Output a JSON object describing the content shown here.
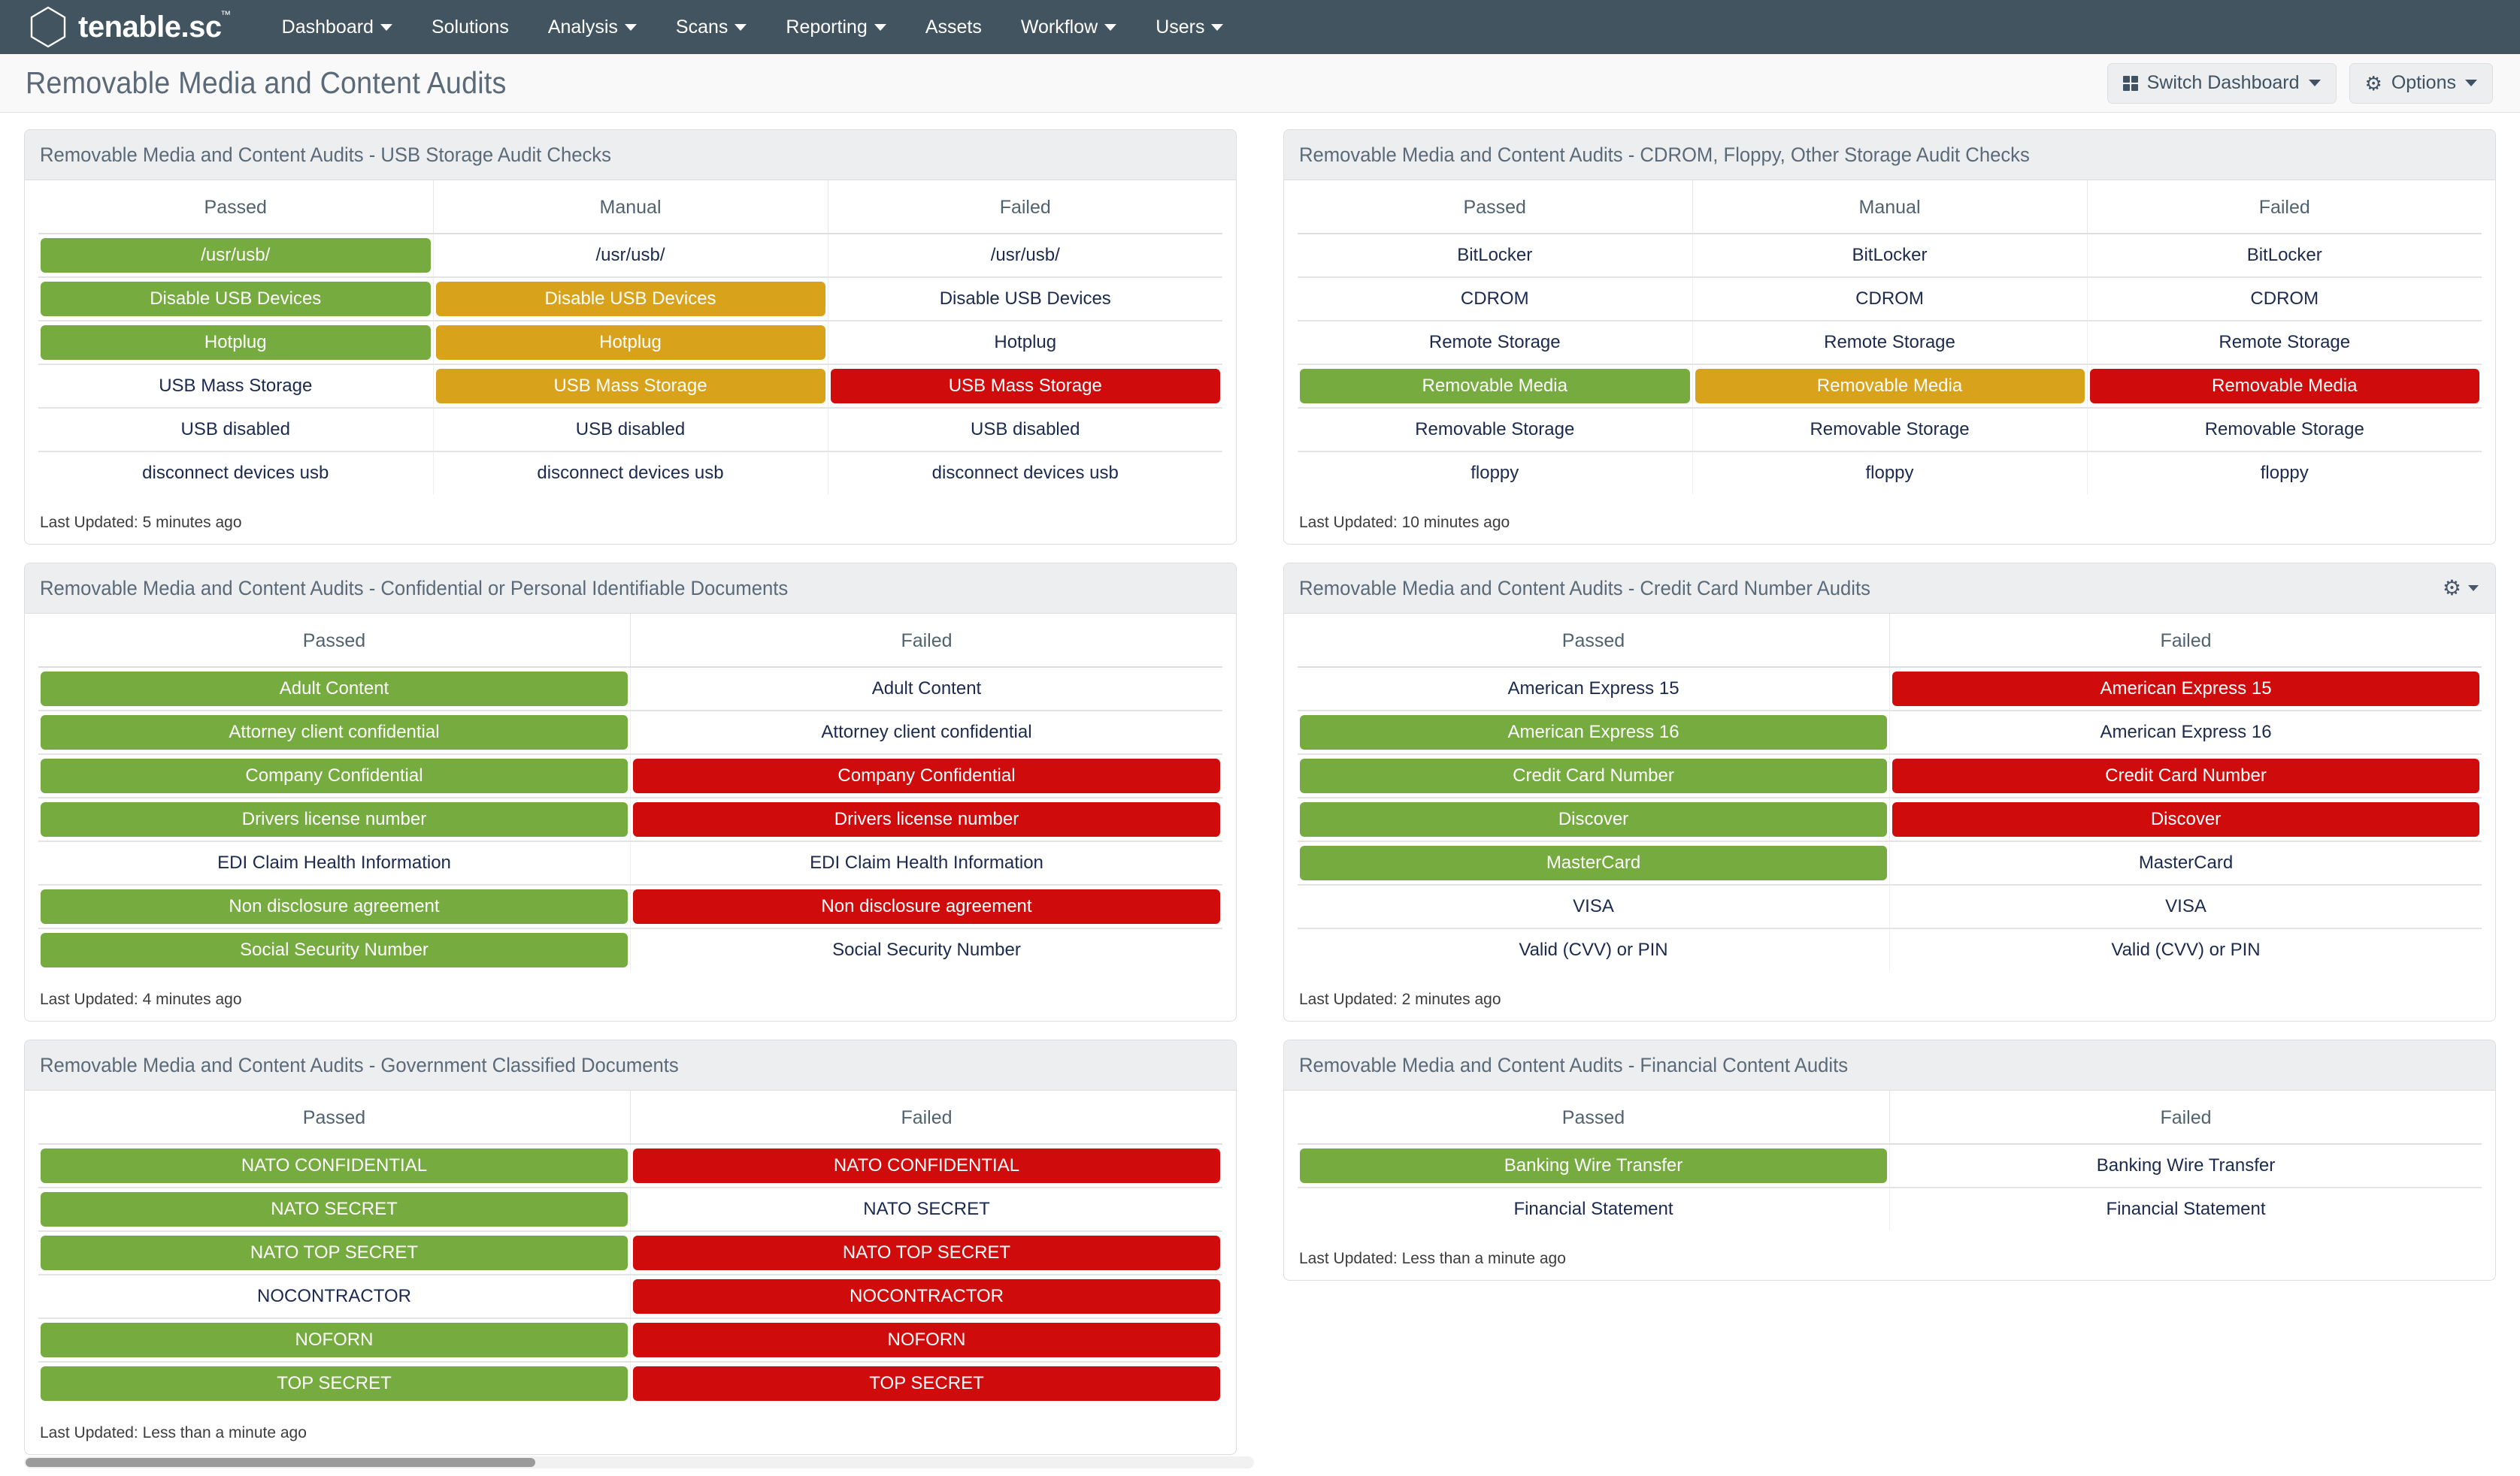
{
  "navbar": {
    "brand": "tenable.sc",
    "brand_tm": "™",
    "items": [
      {
        "label": "Dashboard",
        "caret": true
      },
      {
        "label": "Solutions",
        "caret": false
      },
      {
        "label": "Analysis",
        "caret": true
      },
      {
        "label": "Scans",
        "caret": true
      },
      {
        "label": "Reporting",
        "caret": true
      },
      {
        "label": "Assets",
        "caret": false
      },
      {
        "label": "Workflow",
        "caret": true
      },
      {
        "label": "Users",
        "caret": true
      }
    ]
  },
  "header": {
    "title": "Removable Media and Content Audits",
    "switch_dashboard": "Switch Dashboard",
    "options": "Options"
  },
  "colors": {
    "navbar": "#41545f",
    "pass": "#76ab3f",
    "warn": "#d9a21b",
    "fail": "#cf0b0b",
    "panel_header": "#eceef0",
    "title_text": "#5b6a78"
  },
  "panels": [
    {
      "title": "Removable Media and Content Audits - USB Storage Audit Checks",
      "has_gear": false,
      "columns": [
        "Passed",
        "Manual",
        "Failed"
      ],
      "rows": [
        [
          {
            "text": "/usr/usb/",
            "state": "pass"
          },
          {
            "text": "/usr/usb/",
            "state": "none"
          },
          {
            "text": "/usr/usb/",
            "state": "none"
          }
        ],
        [
          {
            "text": "Disable USB Devices",
            "state": "pass"
          },
          {
            "text": "Disable USB Devices",
            "state": "warn"
          },
          {
            "text": "Disable USB Devices",
            "state": "none"
          }
        ],
        [
          {
            "text": "Hotplug",
            "state": "pass"
          },
          {
            "text": "Hotplug",
            "state": "warn"
          },
          {
            "text": "Hotplug",
            "state": "none"
          }
        ],
        [
          {
            "text": "USB Mass Storage",
            "state": "none"
          },
          {
            "text": "USB Mass Storage",
            "state": "warn"
          },
          {
            "text": "USB Mass Storage",
            "state": "fail"
          }
        ],
        [
          {
            "text": "USB disabled",
            "state": "none"
          },
          {
            "text": "USB disabled",
            "state": "none"
          },
          {
            "text": "USB disabled",
            "state": "none"
          }
        ],
        [
          {
            "text": "disconnect devices usb",
            "state": "none"
          },
          {
            "text": "disconnect devices usb",
            "state": "none"
          },
          {
            "text": "disconnect devices usb",
            "state": "none"
          }
        ]
      ],
      "footer": "Last Updated: 5 minutes ago"
    },
    {
      "title": "Removable Media and Content Audits - CDROM, Floppy, Other Storage Audit Checks",
      "has_gear": false,
      "columns": [
        "Passed",
        "Manual",
        "Failed"
      ],
      "rows": [
        [
          {
            "text": "BitLocker",
            "state": "none"
          },
          {
            "text": "BitLocker",
            "state": "none"
          },
          {
            "text": "BitLocker",
            "state": "none"
          }
        ],
        [
          {
            "text": "CDROM",
            "state": "none"
          },
          {
            "text": "CDROM",
            "state": "none"
          },
          {
            "text": "CDROM",
            "state": "none"
          }
        ],
        [
          {
            "text": "Remote Storage",
            "state": "none"
          },
          {
            "text": "Remote Storage",
            "state": "none"
          },
          {
            "text": "Remote Storage",
            "state": "none"
          }
        ],
        [
          {
            "text": "Removable Media",
            "state": "pass"
          },
          {
            "text": "Removable Media",
            "state": "warn"
          },
          {
            "text": "Removable Media",
            "state": "fail"
          }
        ],
        [
          {
            "text": "Removable Storage",
            "state": "none"
          },
          {
            "text": "Removable Storage",
            "state": "none"
          },
          {
            "text": "Removable Storage",
            "state": "none"
          }
        ],
        [
          {
            "text": "floppy",
            "state": "none"
          },
          {
            "text": "floppy",
            "state": "none"
          },
          {
            "text": "floppy",
            "state": "none"
          }
        ]
      ],
      "footer": "Last Updated: 10 minutes ago"
    },
    {
      "title": "Removable Media and Content Audits - Confidential or Personal Identifiable Documents",
      "has_gear": false,
      "columns": [
        "Passed",
        "Failed"
      ],
      "rows": [
        [
          {
            "text": "Adult Content",
            "state": "pass"
          },
          {
            "text": "Adult Content",
            "state": "none"
          }
        ],
        [
          {
            "text": "Attorney client confidential",
            "state": "pass"
          },
          {
            "text": "Attorney client confidential",
            "state": "none"
          }
        ],
        [
          {
            "text": "Company Confidential",
            "state": "pass"
          },
          {
            "text": "Company Confidential",
            "state": "fail"
          }
        ],
        [
          {
            "text": "Drivers license number",
            "state": "pass"
          },
          {
            "text": "Drivers license number",
            "state": "fail"
          }
        ],
        [
          {
            "text": "EDI Claim Health Information",
            "state": "none"
          },
          {
            "text": "EDI Claim Health Information",
            "state": "none"
          }
        ],
        [
          {
            "text": "Non disclosure agreement",
            "state": "pass"
          },
          {
            "text": "Non disclosure agreement",
            "state": "fail"
          }
        ],
        [
          {
            "text": "Social Security Number",
            "state": "pass"
          },
          {
            "text": "Social Security Number",
            "state": "none"
          }
        ]
      ],
      "footer": "Last Updated: 4 minutes ago"
    },
    {
      "title": "Removable Media and Content Audits - Credit Card Number Audits",
      "has_gear": true,
      "columns": [
        "Passed",
        "Failed"
      ],
      "rows": [
        [
          {
            "text": "American Express 15",
            "state": "none"
          },
          {
            "text": "American Express 15",
            "state": "fail"
          }
        ],
        [
          {
            "text": "American Express 16",
            "state": "pass"
          },
          {
            "text": "American Express 16",
            "state": "none"
          }
        ],
        [
          {
            "text": "Credit Card Number",
            "state": "pass"
          },
          {
            "text": "Credit Card Number",
            "state": "fail"
          }
        ],
        [
          {
            "text": "Discover",
            "state": "pass"
          },
          {
            "text": "Discover",
            "state": "fail"
          }
        ],
        [
          {
            "text": "MasterCard",
            "state": "pass"
          },
          {
            "text": "MasterCard",
            "state": "none"
          }
        ],
        [
          {
            "text": "VISA",
            "state": "none"
          },
          {
            "text": "VISA",
            "state": "none"
          }
        ],
        [
          {
            "text": "Valid (CVV) or PIN",
            "state": "none"
          },
          {
            "text": "Valid (CVV) or PIN",
            "state": "none"
          }
        ]
      ],
      "footer": "Last Updated: 2 minutes ago"
    },
    {
      "title": "Removable Media and Content Audits - Government Classified Documents",
      "has_gear": false,
      "columns": [
        "Passed",
        "Failed"
      ],
      "rows": [
        [
          {
            "text": "NATO CONFIDENTIAL",
            "state": "pass"
          },
          {
            "text": "NATO CONFIDENTIAL",
            "state": "fail"
          }
        ],
        [
          {
            "text": "NATO SECRET",
            "state": "pass"
          },
          {
            "text": "NATO SECRET",
            "state": "none"
          }
        ],
        [
          {
            "text": "NATO TOP SECRET",
            "state": "pass"
          },
          {
            "text": "NATO TOP SECRET",
            "state": "fail"
          }
        ],
        [
          {
            "text": "NOCONTRACTOR",
            "state": "none"
          },
          {
            "text": "NOCONTRACTOR",
            "state": "fail"
          }
        ],
        [
          {
            "text": "NOFORN",
            "state": "pass"
          },
          {
            "text": "NOFORN",
            "state": "fail"
          }
        ],
        [
          {
            "text": "TOP SECRET",
            "state": "pass"
          },
          {
            "text": "TOP SECRET",
            "state": "fail"
          }
        ]
      ],
      "footer": "Last Updated: Less than a minute ago"
    },
    {
      "title": "Removable Media and Content Audits - Financial Content Audits",
      "has_gear": false,
      "columns": [
        "Passed",
        "Failed"
      ],
      "rows": [
        [
          {
            "text": "Banking Wire Transfer",
            "state": "pass"
          },
          {
            "text": "Banking Wire Transfer",
            "state": "none"
          }
        ],
        [
          {
            "text": "Financial Statement",
            "state": "none"
          },
          {
            "text": "Financial Statement",
            "state": "none"
          }
        ]
      ],
      "footer": "Last Updated: Less than a minute ago"
    }
  ]
}
